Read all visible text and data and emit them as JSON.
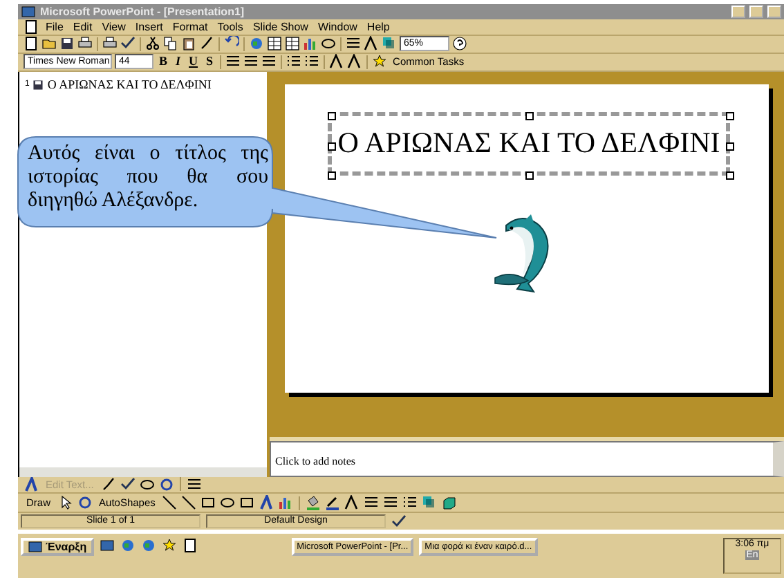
{
  "window": {
    "title": "Microsoft PowerPoint - [Presentation1]",
    "active": false
  },
  "menu": [
    "File",
    "Edit",
    "View",
    "Insert",
    "Format",
    "Tools",
    "Slide Show",
    "Window",
    "Help"
  ],
  "standard_toolbar": {
    "zoom": "65%"
  },
  "formatting_toolbar": {
    "font": "Times New Roman",
    "size": "44",
    "styles": [
      "B",
      "I",
      "U",
      "S"
    ],
    "common_tasks": "Common Tasks"
  },
  "outline": [
    {
      "number": "1",
      "text": "Ο ΑΡΙΩΝΑΣ ΚΑΙ ΤΟ ΔΕΛΦΙΝΙ"
    }
  ],
  "slide": {
    "title": "Ο ΑΡΙΩΝΑΣ ΚΑΙ ΤΟ ΔΕΛΦΙΝΙ",
    "title_selected": true
  },
  "callout": {
    "text": "Αυτός είναι ο τίτλος της ιστορίας που θα σου διηγηθώ Αλέξανδρε."
  },
  "notes": {
    "placeholder": "Click to add notes"
  },
  "wordart_toolbar": {
    "edit_text": "Edit Text...",
    "disabled": true
  },
  "drawing_toolbar": {
    "draw": "Draw",
    "autoshapes": "AutoShapes"
  },
  "status_bar": [
    "Slide 1 of 1",
    "Default Design"
  ],
  "taskbar": {
    "start": "Έναρξη",
    "tasks": [
      {
        "label": "Microsoft PowerPoint - [Pr...",
        "selected": false
      },
      {
        "label": "Μια φορά κι έναν καιρό.d...",
        "selected": false
      }
    ],
    "clock": "3:06 πμ",
    "language": "En"
  }
}
